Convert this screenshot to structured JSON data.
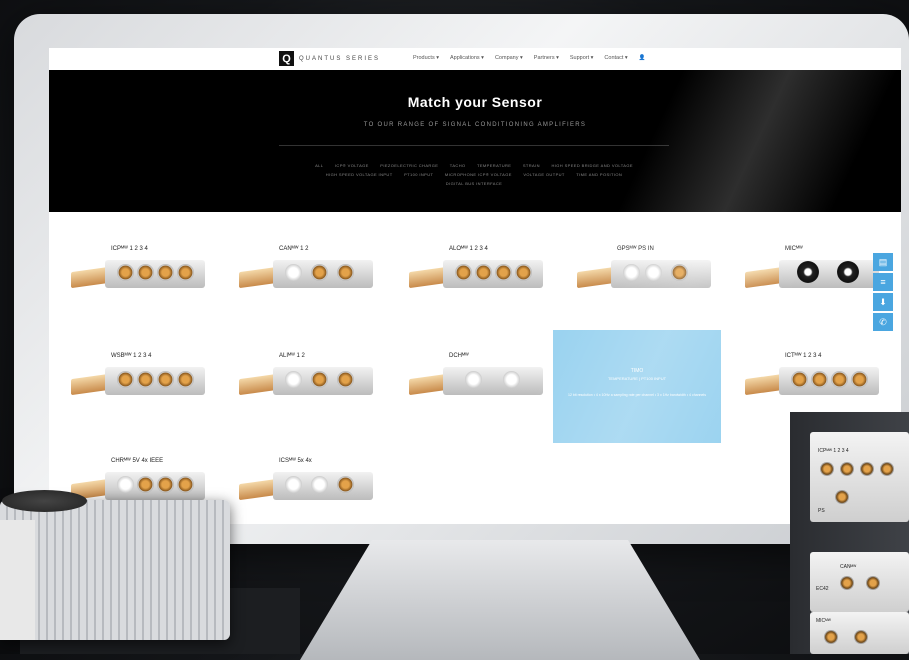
{
  "nav": {
    "logo_letter": "Q",
    "logo_text": "QUANTUS SERIES",
    "menu": [
      "Products ▾",
      "Applications ▾",
      "Company ▾",
      "Partners ▾",
      "Support ▾",
      "Contact ▾",
      "👤"
    ]
  },
  "hero": {
    "title": "Match your Sensor",
    "subtitle": "TO OUR RANGE OF SIGNAL CONDITIONING AMPLIFIERS",
    "filters": [
      "ALL",
      "ICP® VOLTAGE",
      "PIEZOELECTRIC CHARGE",
      "TACHO",
      "TEMPERATURE",
      "STRAIN",
      "HIGH SPEED BRIDGE AND VOLTAGE",
      "HIGH SPEED VOLTAGE INPUT",
      "PT100 INPUT",
      "MICROPHONE ICP® VOLTAGE",
      "VOLTAGE OUTPUT",
      "TIME AND POSITION",
      "DIGITAL BUS INTERFACE"
    ]
  },
  "products": [
    {
      "label": "ICPᴹᵂ 1    2    3    4",
      "style": "copper"
    },
    {
      "label": "CANᴹᵂ        1           2",
      "style": "mixed"
    },
    {
      "label": "ALOᴹᵂ 1    2    3    4",
      "style": "copper"
    },
    {
      "label": "GPSᴹᵂ               PS    IN",
      "style": "mixed"
    },
    {
      "label": "MICᴹᵂ",
      "style": "black"
    },
    {
      "label": "WSBᴹᵂ 1    2    3    4",
      "style": "copper"
    },
    {
      "label": "ALIᴹᵂ          1           2",
      "style": "mixed"
    },
    {
      "label": "DCHᴹᵂ",
      "style": "bnc"
    },
    {
      "label": "ICTᴹᵂ 1    2    3    4",
      "style": "copper"
    },
    {
      "label": "CHRᴹᵂ 5V          4x   IEEE",
      "style": "copper"
    },
    {
      "label": "ICSᴹᵂ          5x          4x",
      "style": "mixed"
    }
  ],
  "highlight": {
    "title": "TIMO",
    "subtitle": "TEMPERATURE | PT100 INPUT",
    "desc": "12 bit resolution • 4 x 10Hz a sampling rate per channel • 3 x 1Hz bandwidth • 4 channels"
  },
  "side_icons": [
    "document-icon",
    "list-icon",
    "download-icon",
    "phone-icon"
  ],
  "hardware": {
    "module1_label": "ICPᴹᵂ  1      2      3      4",
    "module1_ps": "PS",
    "module2_label": "CANᴹᵂ",
    "module2_sub": "EC42",
    "module3_label": "MICᴹᵂ"
  }
}
